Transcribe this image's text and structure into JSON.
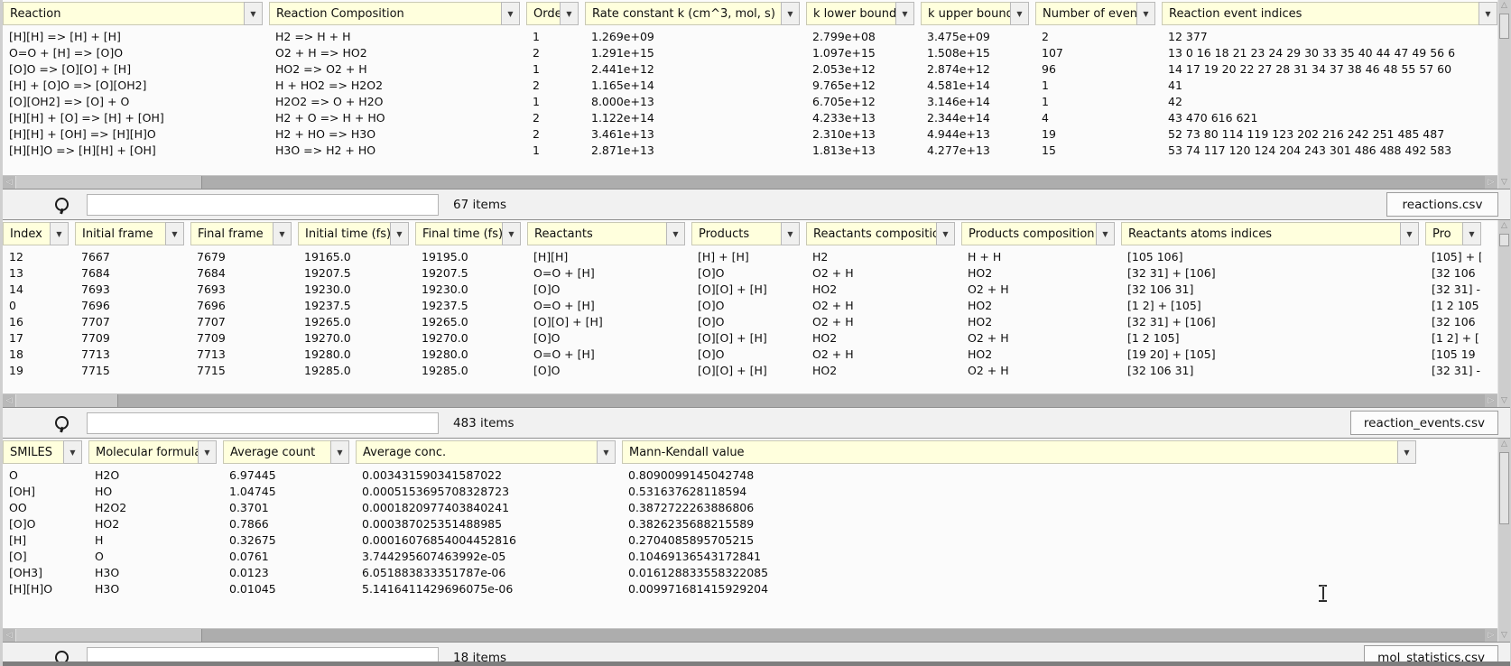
{
  "panels": [
    {
      "file_button": "reactions.csv",
      "items_count": "67 items",
      "columns": [
        "Reaction",
        "Reaction Composition",
        "Order",
        "Rate constant k (cm^3, mol, s)",
        "k lower bound",
        "k upper bound",
        "Number of events",
        "Reaction event indices"
      ],
      "rows": [
        [
          "[H][H] => [H] + [H]",
          "H2 => H + H",
          "1",
          "1.269e+09",
          "2.799e+08",
          "3.475e+09",
          "2",
          "12 377"
        ],
        [
          "O=O + [H] => [O]O",
          "O2 + H => HO2",
          "2",
          "1.291e+15",
          "1.097e+15",
          "1.508e+15",
          "107",
          "13 0 16 18 21 23 24 29 30 33 35 40 44 47 49 56 6"
        ],
        [
          "[O]O => [O][O] + [H]",
          "HO2 => O2 + H",
          "1",
          "2.441e+12",
          "2.053e+12",
          "2.874e+12",
          "96",
          "14 17 19 20 22 27 28 31 34 37 38 46 48 55 57 60"
        ],
        [
          "[H] + [O]O => [O][OH2]",
          "H + HO2 => H2O2",
          "2",
          "1.165e+14",
          "9.765e+12",
          "4.581e+14",
          "1",
          "41"
        ],
        [
          "[O][OH2] => [O] + O",
          "H2O2 => O + H2O",
          "1",
          "8.000e+13",
          "6.705e+12",
          "3.146e+14",
          "1",
          "42"
        ],
        [
          "[H][H] + [O] => [H] + [OH]",
          "H2 + O => H + HO",
          "2",
          "1.122e+14",
          "4.233e+13",
          "2.344e+14",
          "4",
          "43 470 616 621"
        ],
        [
          "[H][H] + [OH] => [H][H]O",
          "H2 + HO => H3O",
          "2",
          "3.461e+13",
          "2.310e+13",
          "4.944e+13",
          "19",
          "52 73 80 114 119 123 202 216 242 251 485 487"
        ],
        [
          "[H][H]O => [H][H] + [OH]",
          "H3O => H2 + HO",
          "1",
          "2.871e+13",
          "1.813e+13",
          "4.277e+13",
          "15",
          "53 74 117 120 124 204 243 301 486 488 492 583"
        ]
      ]
    },
    {
      "file_button": "reaction_events.csv",
      "items_count": "483 items",
      "columns": [
        "Index",
        "Initial frame",
        "Final frame",
        "Initial time (fs)",
        "Final time (fs)",
        "Reactants",
        "Products",
        "Reactants composition",
        "Products composition",
        "Reactants atoms indices",
        "Pro"
      ],
      "rows": [
        [
          "12",
          "7667",
          "7679",
          "19165.0",
          "19195.0",
          "[H][H]",
          "[H] + [H]",
          "H2",
          "H + H",
          "[105 106]",
          "[105] + ["
        ],
        [
          "13",
          "7684",
          "7684",
          "19207.5",
          "19207.5",
          "O=O + [H]",
          "[O]O",
          "O2 + H",
          "HO2",
          "[32 31] + [106]",
          "[32 106"
        ],
        [
          "14",
          "7693",
          "7693",
          "19230.0",
          "19230.0",
          "[O]O",
          "[O][O] + [H]",
          "HO2",
          "O2 + H",
          "[32 106 31]",
          "[32 31] -"
        ],
        [
          "0",
          "7696",
          "7696",
          "19237.5",
          "19237.5",
          "O=O + [H]",
          "[O]O",
          "O2 + H",
          "HO2",
          "[1 2] + [105]",
          "[1 2 105"
        ],
        [
          "16",
          "7707",
          "7707",
          "19265.0",
          "19265.0",
          "[O][O] + [H]",
          "[O]O",
          "O2 + H",
          "HO2",
          "[32 31] + [106]",
          "[32 106"
        ],
        [
          "17",
          "7709",
          "7709",
          "19270.0",
          "19270.0",
          "[O]O",
          "[O][O] + [H]",
          "HO2",
          "O2 + H",
          "[1 2 105]",
          "[1 2] + ["
        ],
        [
          "18",
          "7713",
          "7713",
          "19280.0",
          "19280.0",
          "O=O + [H]",
          "[O]O",
          "O2 + H",
          "HO2",
          "[19 20] + [105]",
          "[105 19"
        ],
        [
          "19",
          "7715",
          "7715",
          "19285.0",
          "19285.0",
          "[O]O",
          "[O][O] + [H]",
          "HO2",
          "O2 + H",
          "[32 106 31]",
          "[32 31] -"
        ]
      ]
    },
    {
      "file_button": "mol_statistics.csv",
      "items_count": "18 items",
      "columns": [
        "SMILES",
        "Molecular formula",
        "Average count",
        "Average conc.",
        "Mann-Kendall value"
      ],
      "rows": [
        [
          "O",
          "H2O",
          "6.97445",
          "0.003431590341587022",
          "0.8090099145042748"
        ],
        [
          "[OH]",
          "HO",
          "1.04745",
          "0.0005153695708328723",
          "0.531637628118594"
        ],
        [
          "OO",
          "H2O2",
          "0.3701",
          "0.0001820977403840241",
          "0.3872722263886806"
        ],
        [
          "[O]O",
          "HO2",
          "0.7866",
          "0.000387025351488985",
          "0.3826235688215589"
        ],
        [
          "[H]",
          "H",
          "0.32675",
          "0.00016076854004452816",
          "0.2704085895705215"
        ],
        [
          "[O]",
          "O",
          "0.0761",
          "3.744295607463992e-05",
          "0.10469136543172841"
        ],
        [
          "[OH3]",
          "H3O",
          "0.0123",
          "6.051883833351787e-06",
          "0.016128833558322085"
        ],
        [
          "[H][H]O",
          "H3O",
          "0.01045",
          "5.1416411429696075e-06",
          "0.009971681415929204"
        ]
      ]
    }
  ],
  "icons": {
    "dropdown_arrow": "▼",
    "scroll_left": "◁",
    "scroll_right": "▷",
    "scroll_up": "△",
    "scroll_down": "▽"
  },
  "colors": {
    "header_bg": "#ffffdd",
    "panel_bg": "#fbfbfb",
    "searchbar_bg": "#f1f1f1",
    "scroll_track": "#adadad"
  }
}
